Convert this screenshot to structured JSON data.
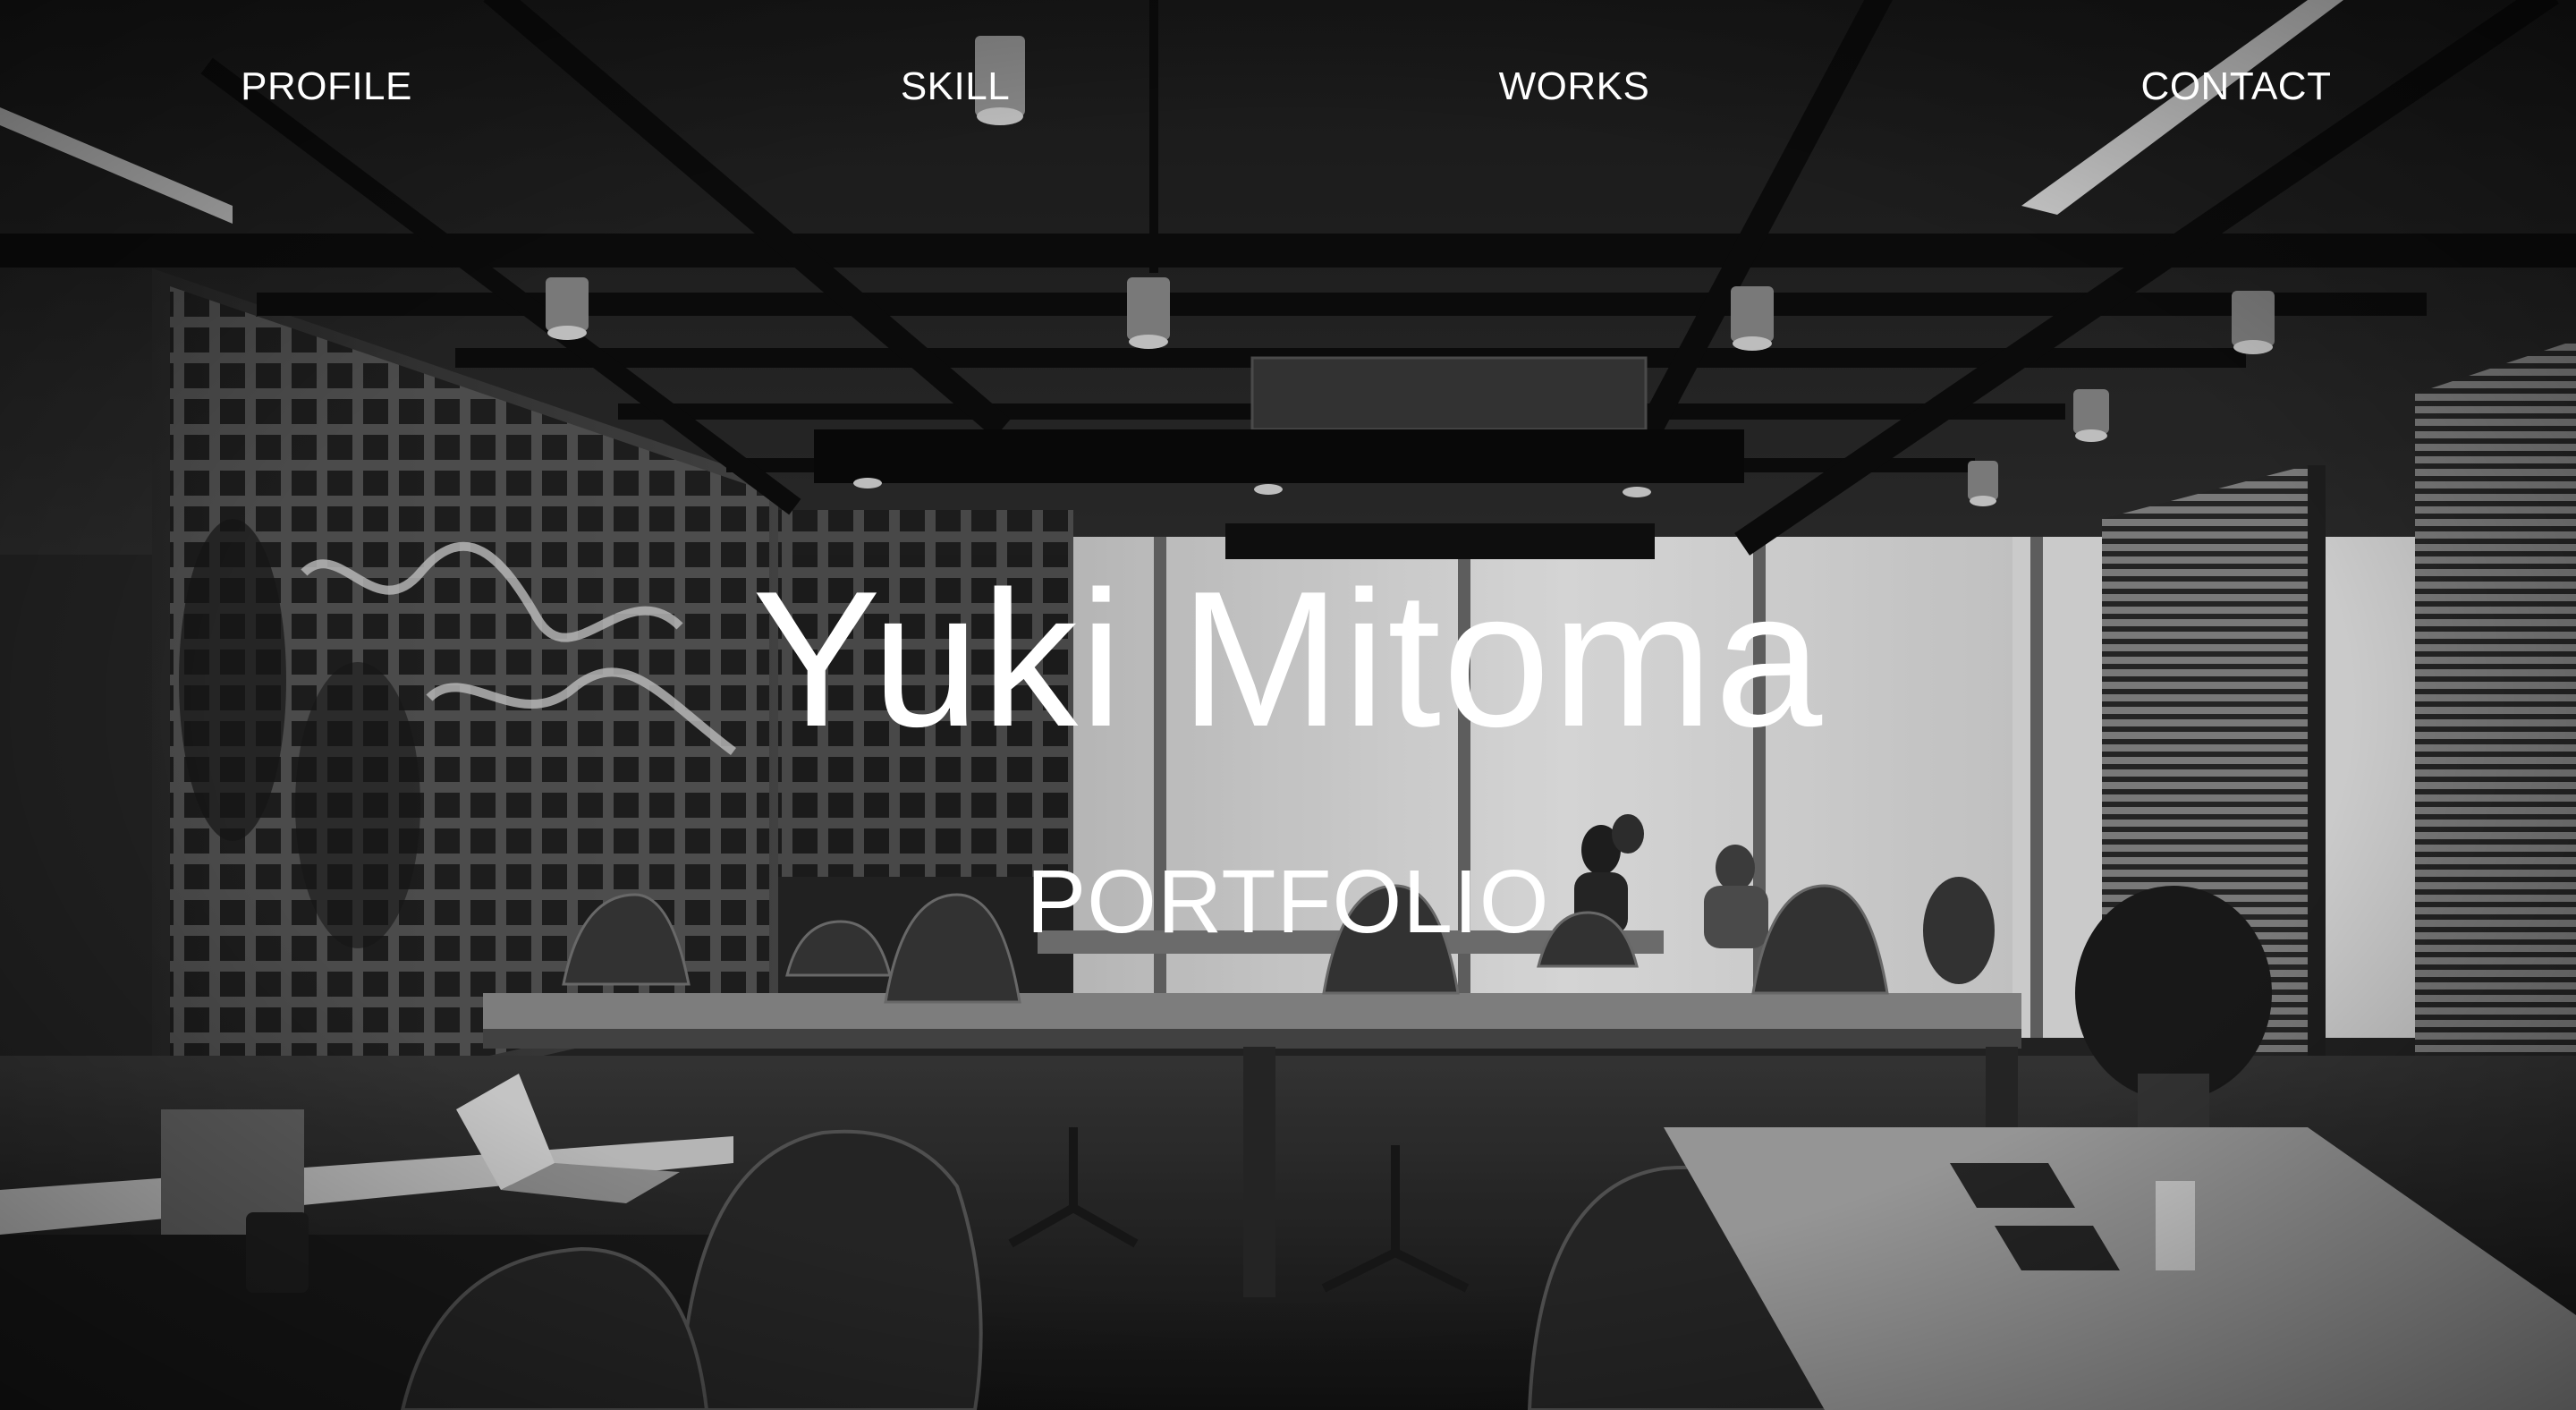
{
  "nav": {
    "items": [
      {
        "label": "PROFILE"
      },
      {
        "label": "SKILL"
      },
      {
        "label": "WORKS"
      },
      {
        "label": "CONTACT"
      }
    ]
  },
  "hero": {
    "title": "Yuki Mitoma",
    "subtitle": "PORTFOLIO",
    "background": "office-photo-grayscale"
  },
  "colors": {
    "text": "#ffffff",
    "overlay": "#000000"
  }
}
